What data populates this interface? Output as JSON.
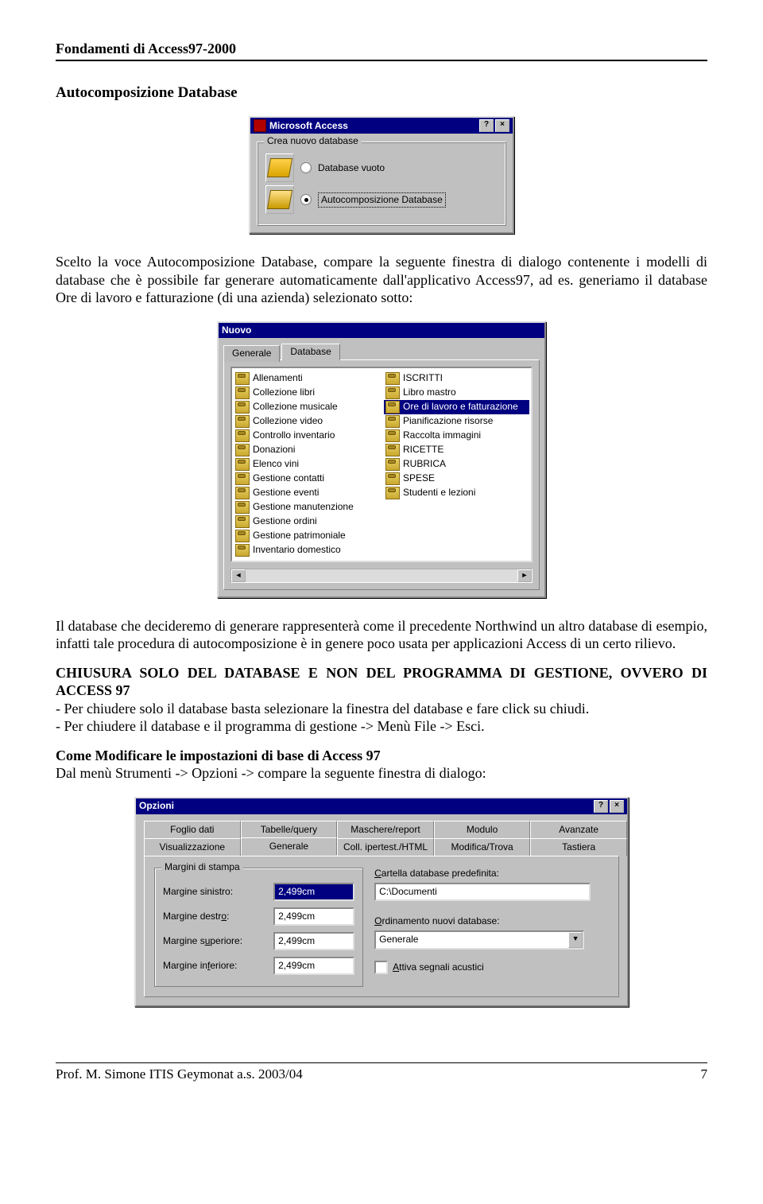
{
  "running_header": "Fondamenti di Access97-2000",
  "section_title": "Autocomposizione Database",
  "dialog1": {
    "title": "Microsoft Access",
    "group_legend": "Crea nuovo database",
    "opt_blank": "Database vuoto",
    "opt_wizard": "Autocomposizione Database"
  },
  "para1": "Scelto la voce Autocomposizione Database, compare la seguente finestra di dialogo contenente i modelli di database che è possibile far generare automaticamente dall'applicativo Access97, ad es. generiamo il database Ore di lavoro e fatturazione (di una azienda) selezionato sotto:",
  "dialog2": {
    "title": "Nuovo",
    "tab_general": "Generale",
    "tab_database": "Database",
    "col1": [
      "Allenamenti",
      "Collezione libri",
      "Collezione musicale",
      "Collezione video",
      "Controllo inventario",
      "Donazioni",
      "Elenco vini",
      "Gestione contatti",
      "Gestione eventi",
      "Gestione manutenzione",
      "Gestione ordini",
      "Gestione patrimoniale",
      "Inventario domestico"
    ],
    "col2": [
      "ISCRITTI",
      "Libro mastro",
      "Ore di lavoro e fatturazione",
      "Pianificazione risorse",
      "Raccolta immagini",
      "RICETTE",
      "RUBRICA",
      "SPESE",
      "Studenti e lezioni"
    ],
    "selected": "Ore di lavoro e fatturazione"
  },
  "para2": "Il database che decideremo di generare rappresenterà come il precedente Northwind un altro database di esempio, infatti tale procedura di autocomposizione è in genere poco usata per applicazioni Access di un certo rilievo.",
  "caps_heading": "CHIUSURA SOLO DEL DATABASE E NON DEL PROGRAMMA DI GESTIONE, OVVERO DI ACCESS 97",
  "bullet1": "- Per chiudere solo il database basta selezionare la finestra del database e fare click su chiudi.",
  "bullet2": "- Per chiudere il database e il programma di gestione -> Menù File -> Esci.",
  "subhead": "Come Modificare le impostazioni di base di Access 97",
  "para3": "Dal menù Strumenti -> Opzioni -> compare la seguente finestra di dialogo:",
  "dialog3": {
    "title": "Opzioni",
    "tabs_row1": [
      "Foglio dati",
      "Tabelle/query",
      "Maschere/report",
      "Modulo",
      "Avanzate"
    ],
    "tabs_row2": [
      "Visualizzazione",
      "Generale",
      "Coll. ipertest./HTML",
      "Modifica/Trova",
      "Tastiera"
    ],
    "active_tab": "Generale",
    "margins_legend": "Margini di stampa",
    "lbl_left": "Margine sinistro:",
    "val_left": "2,499cm",
    "lbl_right": "Margine destro:",
    "val_right": "2,499cm",
    "lbl_top": "Margine superiore:",
    "val_top": "2,499cm",
    "lbl_bottom": "Margine inferiore:",
    "val_bottom": "2,499cm",
    "lbl_folder": "Cartella database predefinita:",
    "val_folder": "C:\\Documenti",
    "lbl_sort": "Ordinamento nuovi database:",
    "val_sort": "Generale",
    "chk_sound": "Attiva segnali acustici"
  },
  "footer_left": "Prof.  M.  Simone  ITIS  Geymonat  a.s. 2003/04",
  "footer_right": "7"
}
